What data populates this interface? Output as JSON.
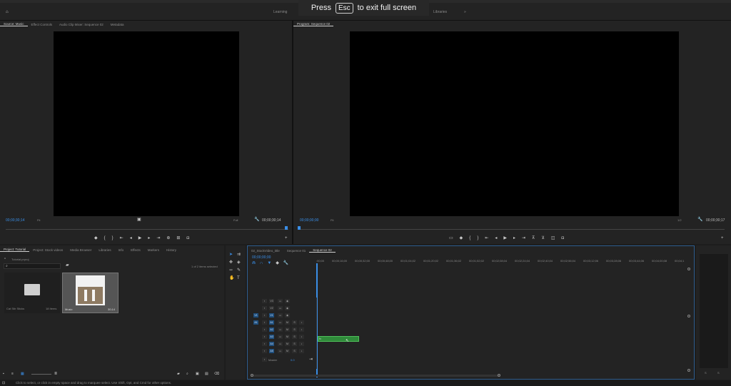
{
  "fullscreen_notice": {
    "press": "Press",
    "key": "Esc",
    "rest": "to exit full screen"
  },
  "workspace": {
    "tabs": [
      "Learning",
      "Libraries"
    ],
    "more": "»"
  },
  "source_panel": {
    "tabs": [
      "Source: Music",
      "Effect Controls",
      "Audio Clip Mixer: Sequence 02",
      "Metadata"
    ],
    "timecode_in": "00;00;30;14",
    "fit": "Fit",
    "quality": "Full",
    "timecode_out": "00;00;30;14"
  },
  "program_panel": {
    "tab": "Program: Sequence 02",
    "timecode_in": "00;00;00;00",
    "fit": "Fit",
    "ratio": "1/2",
    "timecode_out": "00;00;30;17"
  },
  "project_panel": {
    "tabs": [
      "Project: Tutorial",
      "Project: Stock videos",
      "Media Browser",
      "Libraries",
      "Info",
      "Effects",
      "Markers",
      "History"
    ],
    "file": "Tutorial.prproj",
    "selection": "1 of 2 items selected",
    "items": [
      {
        "name": "Cat Stir Sticks",
        "meta": "18 Items"
      },
      {
        "name": "Music",
        "meta": "30;14"
      }
    ]
  },
  "timeline": {
    "tabs": [
      "02_StockVideo_title",
      "Sequence 01",
      "Sequence 02"
    ],
    "timecode": "00;00;00;00",
    "ruler": [
      ":00;00",
      "00;00;16;00",
      "00;00;32;00",
      "00;00;48;00",
      "00;01;04;02",
      "00;01;20;02",
      "00;01;36;02",
      "00;01;52;02",
      "00;02;08;04",
      "00;02;24;04",
      "00;02;40;04",
      "00;02;56;04",
      "00;03;12;06",
      "00;03;28;06",
      "00;03;44;06",
      "00;04;00;08",
      "00;04;1"
    ],
    "video_tracks": [
      "V3",
      "V2",
      "V1"
    ],
    "audio_tracks": [
      "A1",
      "A2",
      "A3",
      "A4",
      "A5"
    ],
    "master": {
      "label": "Master",
      "value": "0.0"
    }
  },
  "status_bar": "Click to select, or click in empty space and drag to marquee select. Use Shift, Opt, and Cmd for other options.",
  "colors": {
    "accent": "#3a8ee6",
    "clip": "#2f8a3a"
  }
}
